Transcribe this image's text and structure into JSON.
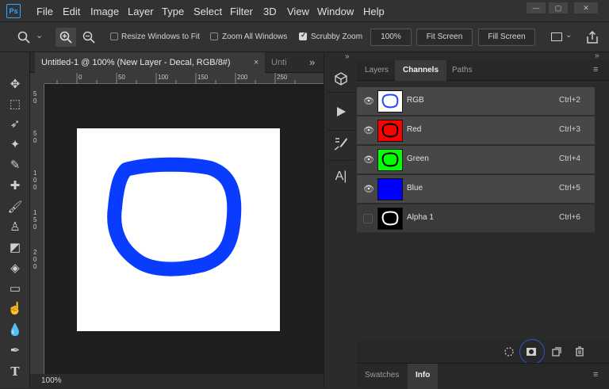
{
  "app": {
    "logo": "Ps"
  },
  "menu": [
    "File",
    "Edit",
    "Image",
    "Layer",
    "Type",
    "Select",
    "Filter",
    "3D",
    "View",
    "Window",
    "Help"
  ],
  "window_controls": {
    "minimize": "—",
    "restore": "▢",
    "close": "✕"
  },
  "options_bar": {
    "zoom_tool_icon": "zoom-icon",
    "dropdown_arrow": "⌄",
    "zoom_in_icon": "zoom-in-icon",
    "zoom_out_icon": "zoom-out-icon",
    "resize_windows_label": "Resize Windows to Fit",
    "resize_windows_checked": false,
    "zoom_all_windows_label": "Zoom All Windows",
    "zoom_all_windows_checked": false,
    "scrubby_zoom_label": "Scrubby Zoom",
    "scrubby_zoom_checked": true,
    "zoom_percent": "100%",
    "fit_screen_label": "Fit Screen",
    "fill_screen_label": "Fill Screen"
  },
  "document": {
    "tab_title": "Untitled-1 @ 100% (New Layer - Decal, RGB/8#)",
    "tab_close": "×",
    "next_tab": "Unti",
    "collapse_arrows": "»",
    "ruler_top_labels": [
      "0",
      "50",
      "100",
      "150",
      "200",
      "250"
    ],
    "ruler_left_labels": [
      "5",
      "0",
      "5",
      "0",
      "1",
      "0",
      "0",
      "1",
      "5",
      "0",
      "2",
      "0",
      "0"
    ],
    "status_zoom": "100%"
  },
  "tools": [
    {
      "name": "move-tool",
      "glyph": "✥"
    },
    {
      "name": "marquee-tool",
      "glyph": "⬚"
    },
    {
      "name": "lasso-tool",
      "glyph": "➶"
    },
    {
      "name": "magic-wand-tool",
      "glyph": "✦"
    },
    {
      "name": "eyedropper-tool",
      "glyph": "✎"
    },
    {
      "name": "healing-brush-tool",
      "glyph": "✚"
    },
    {
      "name": "brush-tool",
      "glyph": "🖌"
    },
    {
      "name": "clone-stamp-tool",
      "glyph": "♙"
    },
    {
      "name": "eraser-tool",
      "glyph": "◩"
    },
    {
      "name": "paint-bucket-tool",
      "glyph": "◈"
    },
    {
      "name": "gradient-tool",
      "glyph": "▭"
    },
    {
      "name": "smudge-tool",
      "glyph": "☝"
    },
    {
      "name": "blur-tool",
      "glyph": "💧"
    },
    {
      "name": "pen-tool",
      "glyph": "✒"
    },
    {
      "name": "type-tool",
      "glyph": "T"
    }
  ],
  "panels": {
    "tabs": [
      "Layers",
      "Channels",
      "Paths"
    ],
    "active_tab": "Channels",
    "channels": [
      {
        "name": "RGB",
        "shortcut": "Ctrl+2",
        "visible": true,
        "thumb_bg": "#ffffff",
        "stroke": "#1f4bff"
      },
      {
        "name": "Red",
        "shortcut": "Ctrl+3",
        "visible": true,
        "thumb_bg": "#ff0000",
        "stroke": "#000000"
      },
      {
        "name": "Green",
        "shortcut": "Ctrl+4",
        "visible": true,
        "thumb_bg": "#00ff00",
        "stroke": "#000000"
      },
      {
        "name": "Blue",
        "shortcut": "Ctrl+5",
        "visible": true,
        "thumb_bg": "#0000ff",
        "stroke": "#0000ff"
      },
      {
        "name": "Alpha 1",
        "shortcut": "Ctrl+6",
        "visible": false,
        "thumb_bg": "#000000",
        "stroke": "#ffffff"
      }
    ],
    "bottom_tabs": [
      "Swatches",
      "Info"
    ],
    "bottom_active": "Info"
  },
  "colors": {
    "accent": "#31a8ff",
    "stroke_blue": "#0a3cff",
    "highlight_circle": "#2a55cc"
  }
}
